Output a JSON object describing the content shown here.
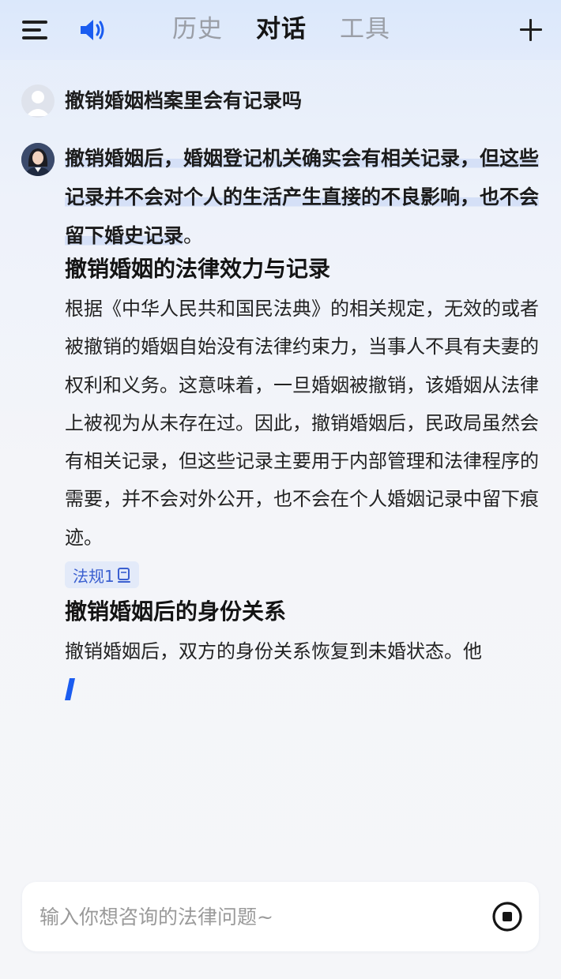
{
  "header": {
    "tabs": [
      {
        "label": "历史",
        "active": false
      },
      {
        "label": "对话",
        "active": true
      },
      {
        "label": "工具",
        "active": false
      }
    ],
    "icons": {
      "menu": "menu-icon",
      "speaker": "speaker-icon",
      "new_chat": "plus-icon"
    },
    "accent_color": "#1a5cf0"
  },
  "conversation": {
    "user_question": "撤销婚姻档案里会有记录吗",
    "answer": {
      "summary_highlighted": "撤销婚姻后，婚姻登记机关确实会有相关记录，但这些记录并不会对个人的生活产生直接的不良影响，也不会留下婚史记录",
      "summary_tail": "。",
      "sections": [
        {
          "heading": "撤销婚姻的法律效力与记录",
          "body": "根据《中华人民共和国民法典》的相关规定，无效的或者被撤销的婚姻自始没有法律约束力，当事人不具有夫妻的权利和义务。这意味着，一旦婚姻被撤销，该婚姻从法律上被视为从未存在过。因此，撤销婚姻后，民政局虽然会有相关记录，但这些记录主要用于内部管理和法律程序的需要，并不会对外公开，也不会在个人婚姻记录中留下痕迹。",
          "citation": "法规1"
        },
        {
          "heading": "撤销婚姻后的身份关系",
          "body": "撤销婚姻后，双方的身份关系恢复到未婚状态。他"
        }
      ]
    }
  },
  "input": {
    "placeholder": "输入你想咨询的法律问题~",
    "value": ""
  }
}
